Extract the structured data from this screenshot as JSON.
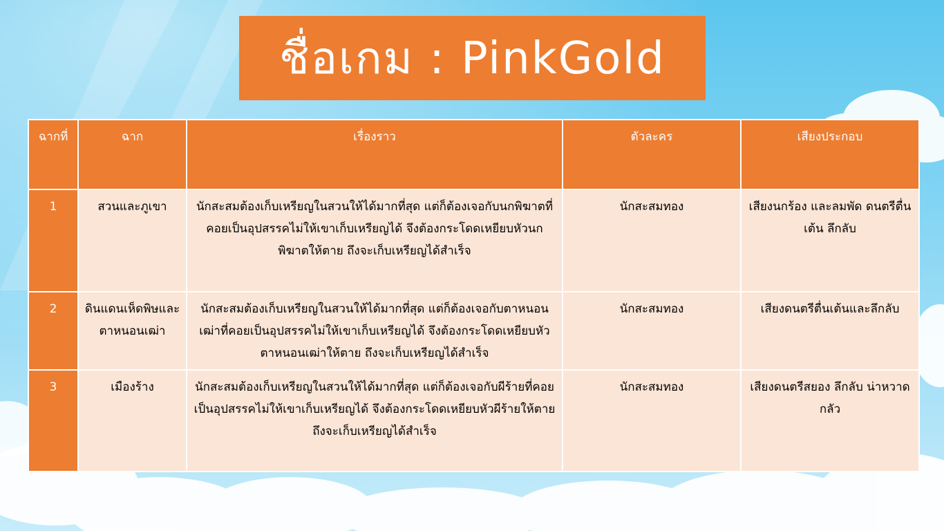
{
  "slide": {
    "title": "ชื่อเกม : PinkGold",
    "colors": {
      "accent": "#ed7d31",
      "cell_background": "#fbe5d6",
      "sky_top": "#5cc6ee",
      "sky_bottom": "#c7ecfa"
    }
  },
  "table": {
    "headers": [
      "ฉากที่",
      "ฉาก",
      "เรื่องราว",
      "ตัวละคร",
      "เสียงประกอบ"
    ],
    "rows": [
      {
        "no": "1",
        "scene": "สวนและภูเขา",
        "story": "นักสะสมต้องเก็บเหรียญในสวนให้ได้มากที่สุด แต่ก็ต้องเจอกับนกพิฆาตที่คอยเป็นอุปสรรคไม่ให้เขาเก็บเหรียญได้ จึงต้องกระโดดเหยียบหัวนกพิฆาตให้ตาย ถึงจะเก็บเหรียญได้สำเร็จ",
        "character": "นักสะสมทอง",
        "sound": "เสียงนกร้อง และลมพัด ดนตรีตื่นเต้น ลึกลับ"
      },
      {
        "no": "2",
        "scene": "ดินแดนเห็ดพิษและตาหนอนเฒ่า",
        "story": "นักสะสมต้องเก็บเหรียญในสวนให้ได้มากที่สุด แต่ก็ต้องเจอกับตาหนอนเฒ่าที่คอยเป็นอุปสรรคไม่ให้เขาเก็บเหรียญได้ จึงต้องกระโดดเหยียบหัวตาหนอนเฒ่าให้ตาย ถึงจะเก็บเหรียญได้สำเร็จ",
        "character": "นักสะสมทอง",
        "sound": "เสียงดนตรีตื่นเต้นและลึกลับ"
      },
      {
        "no": "3",
        "scene": "เมืองร้าง",
        "story": "นักสะสมต้องเก็บเหรียญในสวนให้ได้มากที่สุด แต่ก็ต้องเจอกับผีร้ายที่คอยเป็นอุปสรรคไม่ให้เขาเก็บเหรียญได้ จึงต้องกระโดดเหยียบหัวผีร้ายให้ตาย ถึงจะเก็บเหรียญได้สำเร็จ",
        "character": "นักสะสมทอง",
        "sound": "เสียงดนตรีสยอง ลึกลับ น่าหวาดกลัว"
      }
    ]
  }
}
